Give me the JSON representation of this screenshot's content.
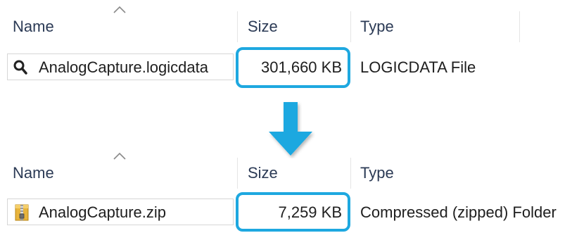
{
  "columns": {
    "name": "Name",
    "size": "Size",
    "type": "Type"
  },
  "before": {
    "file_name": "AnalogCapture.logicdata",
    "file_size": "301,660 KB",
    "file_type": "LOGICDATA File",
    "icon": "magnifier-file-icon"
  },
  "after": {
    "file_name": "AnalogCapture.zip",
    "file_size": "7,259 KB",
    "file_type": "Compressed (zipped) Folder",
    "icon": "zip-folder-icon"
  },
  "colors": {
    "highlight": "#1ea8e0",
    "arrow": "#1ea8e0",
    "header_text": "#2b3a55"
  }
}
